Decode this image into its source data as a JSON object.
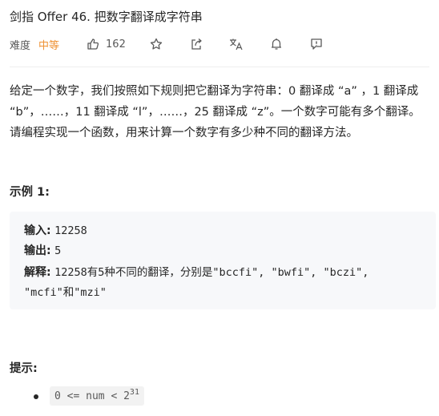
{
  "problem": {
    "title": "剑指 Offer 46. 把数字翻译成字符串",
    "difficulty_label": "难度",
    "difficulty": "中等",
    "likes": "162",
    "description": "给定一个数字，我们按照如下规则把它翻译为字符串：0 翻译成 “a” ，1 翻译成 “b”，……，11 翻译成 “l”，……，25 翻译成 “z”。一个数字可能有多个翻译。请编程实现一个函数，用来计算一个数字有多少种不同的翻译方法。"
  },
  "example": {
    "heading": "示例 1:",
    "input_label": "输入:",
    "input_value": "12258",
    "output_label": "输出:",
    "output_value": "5",
    "explain_label": "解释:",
    "explain_value_1": "12258有5种不同的翻译，分别是\"bccfi\", \"bwfi\", \"bczi\",",
    "explain_value_2": "\"mcfi\"和\"mzi\""
  },
  "hints": {
    "heading": "提示:",
    "constraint_prefix": "0 <= num < 2",
    "constraint_exp": "31"
  },
  "icons": [
    "thumbs-up-icon",
    "star-icon",
    "share-icon",
    "translate-icon",
    "bell-icon",
    "feedback-icon"
  ],
  "colors": {
    "difficulty": "#ef9234",
    "example_bg": "#f7f8fa"
  }
}
